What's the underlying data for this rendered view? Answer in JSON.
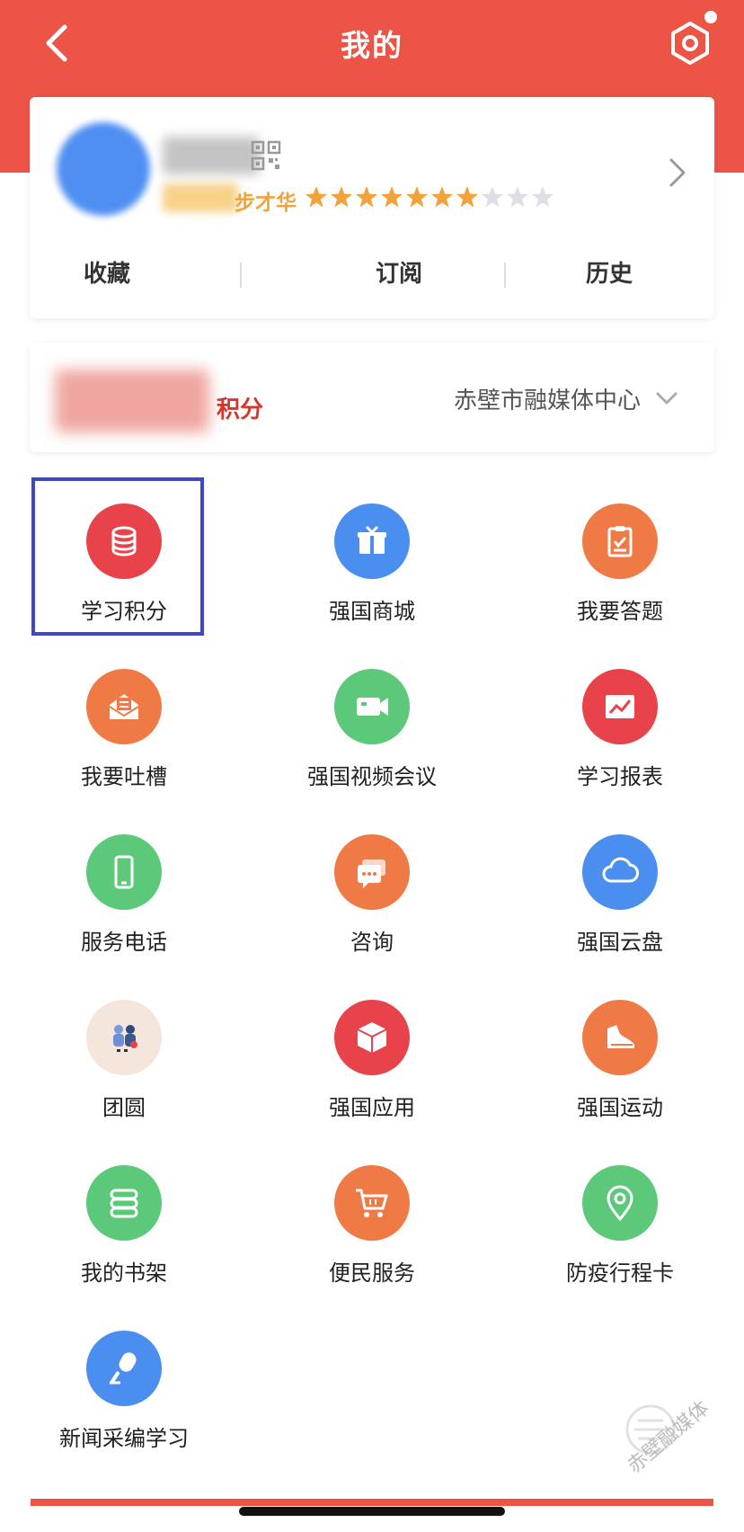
{
  "header": {
    "title": "我的"
  },
  "profile": {
    "level_title": "步才华",
    "stars": {
      "filled": 7,
      "total": 10
    },
    "stats": [
      "收藏",
      "订阅",
      "历史"
    ]
  },
  "points": {
    "unit": "积分",
    "organization": "赤壁市融媒体中心"
  },
  "grid": [
    {
      "label": "学习积分",
      "icon": "database-icon",
      "color": "#e8434a"
    },
    {
      "label": "强国商城",
      "icon": "gift-box-icon",
      "color": "#4a8ef0"
    },
    {
      "label": "我要答题",
      "icon": "clipboard-check-icon",
      "color": "#f07a45"
    },
    {
      "label": "我要吐槽",
      "icon": "envelope-icon",
      "color": "#f07a45"
    },
    {
      "label": "强国视频会议",
      "icon": "video-camera-icon",
      "color": "#5cc87a"
    },
    {
      "label": "学习报表",
      "icon": "chart-image-icon",
      "color": "#e8434a"
    },
    {
      "label": "服务电话",
      "icon": "phone-icon",
      "color": "#5cc87a"
    },
    {
      "label": "咨询",
      "icon": "chat-icon",
      "color": "#f07a45"
    },
    {
      "label": "强国云盘",
      "icon": "cloud-icon",
      "color": "#4a8ef0"
    },
    {
      "label": "团圆",
      "icon": "family-illustration-icon",
      "color": "#f5e6dc"
    },
    {
      "label": "强国应用",
      "icon": "cube-icon",
      "color": "#e8434a"
    },
    {
      "label": "强国运动",
      "icon": "shoe-icon",
      "color": "#f07a45"
    },
    {
      "label": "我的书架",
      "icon": "book-scroll-icon",
      "color": "#5cc87a"
    },
    {
      "label": "便民服务",
      "icon": "shopping-cart-icon",
      "color": "#f07a45"
    },
    {
      "label": "防疫行程卡",
      "icon": "location-pin-icon",
      "color": "#5cc87a"
    },
    {
      "label": "新闻采编学习",
      "icon": "microphone-icon",
      "color": "#4a8ef0"
    }
  ],
  "watermark": {
    "text": "赤壁融媒体"
  }
}
